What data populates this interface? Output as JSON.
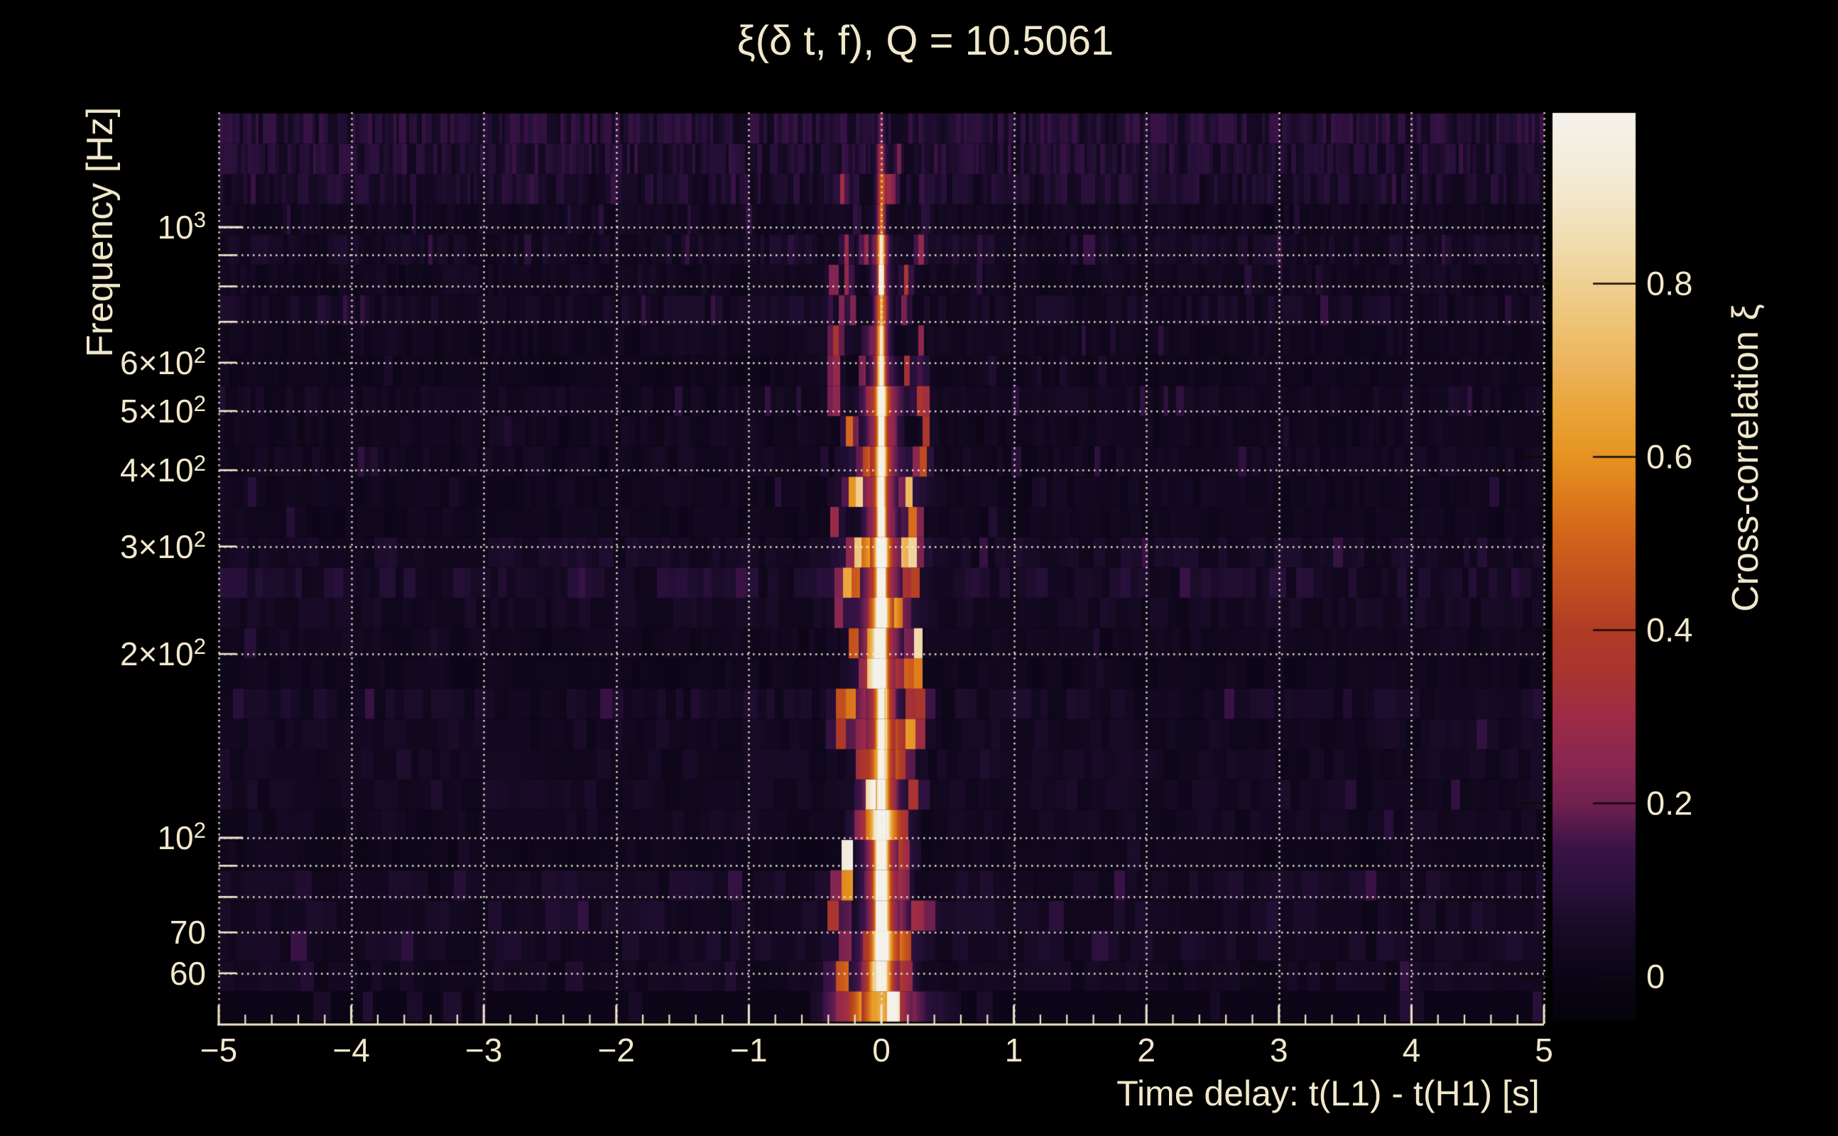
{
  "title": {
    "text": "ξ(δ t, f), Q = 10.5061",
    "q_value": 10.5061
  },
  "colors": {
    "background": "#000000",
    "text": "#f1e8cb",
    "grid": "#f2ecd4",
    "axis": "#f1e8cb",
    "colorbar_tick": "#10090a"
  },
  "chart_data": {
    "type": "heatmap",
    "title": "ξ(δ t, f), Q = 10.5061",
    "xlabel": "Time delay: t(L1) - t(H1) [s]",
    "ylabel": "Frequency [Hz]",
    "colorbar_label": "Cross-correlation ξ",
    "x_range_s": [
      -5,
      5
    ],
    "x_major_tick_step_s": 1,
    "x_minor_tick_step_s": 0.2,
    "y_scale": "log",
    "y_range_hz": [
      50,
      1536
    ],
    "grid": "dotted, at every integer time delay and every decade-multiple frequency",
    "legend_position": "right colorbar",
    "colorbar_value_range": [
      -0.05,
      1.0
    ],
    "colorbar_tick_values": [
      0,
      0.2,
      0.4,
      0.6,
      0.8
    ],
    "colormap_stops": [
      [
        -0.06,
        "#040207"
      ],
      [
        0.0,
        "#0b0516"
      ],
      [
        0.05,
        "#160a24"
      ],
      [
        0.1,
        "#271039"
      ],
      [
        0.15,
        "#3c1347"
      ],
      [
        0.2,
        "#70204f"
      ],
      [
        0.25,
        "#8b2750"
      ],
      [
        0.3,
        "#9d2b46"
      ],
      [
        0.35,
        "#a93430"
      ],
      [
        0.4,
        "#b03c26"
      ],
      [
        0.45,
        "#c14e1f"
      ],
      [
        0.5,
        "#d0601b"
      ],
      [
        0.55,
        "#dc791c"
      ],
      [
        0.6,
        "#e59320"
      ],
      [
        0.65,
        "#e9a337"
      ],
      [
        0.7,
        "#ecb258"
      ],
      [
        0.75,
        "#eec274"
      ],
      [
        0.8,
        "#efd092"
      ],
      [
        0.85,
        "#f1ddb1"
      ],
      [
        0.9,
        "#f3e7cb"
      ],
      [
        0.95,
        "#f4eedf"
      ],
      [
        1.0,
        "#f5f2ec"
      ]
    ],
    "background_noise_xi_range": [
      0.0,
      0.12
    ],
    "ridge": {
      "center_time_delay_s": 0.0,
      "core_width_s_at_100hz": 0.06,
      "side_lobe_offsets_s": [
        -0.3,
        -0.19,
        -0.12,
        0.12,
        0.15,
        0.3
      ],
      "band_peak_xi": [
        {
          "f_hz": [
            50,
            57
          ],
          "peak_xi": 0.55
        },
        {
          "f_hz": [
            57,
            66
          ],
          "peak_xi": 0.9
        },
        {
          "f_hz": [
            66,
            115
          ],
          "peak_xi": 1.0
        },
        {
          "f_hz": [
            115,
            320
          ],
          "peak_xi": 0.95
        },
        {
          "f_hz": [
            320,
            650
          ],
          "peak_xi": 0.85
        },
        {
          "f_hz": [
            650,
            950
          ],
          "peak_xi": 0.7
        },
        {
          "f_hz": [
            950,
            1250
          ],
          "peak_xi": 0.4
        },
        {
          "f_hz": [
            1250,
            1536
          ],
          "peak_xi": 0.2
        }
      ]
    }
  },
  "axes": {
    "x": {
      "title": "Time delay: t(L1) - t(H1) [s]",
      "ticks": [
        {
          "v": -5,
          "label": "−5"
        },
        {
          "v": -4,
          "label": "−4"
        },
        {
          "v": -3,
          "label": "−3"
        },
        {
          "v": -2,
          "label": "−2"
        },
        {
          "v": -1,
          "label": "−1"
        },
        {
          "v": 0,
          "label": "0"
        },
        {
          "v": 1,
          "label": "1"
        },
        {
          "v": 2,
          "label": "2"
        },
        {
          "v": 3,
          "label": "3"
        },
        {
          "v": 4,
          "label": "4"
        },
        {
          "v": 5,
          "label": "5"
        }
      ]
    },
    "y": {
      "title": "Frequency [Hz]",
      "grid_freqs_hz": [
        60,
        70,
        80,
        90,
        100,
        200,
        300,
        400,
        500,
        600,
        700,
        800,
        900,
        1000
      ],
      "ticks": [
        {
          "f": 1000,
          "base": "10",
          "sup": "3"
        },
        {
          "f": 600,
          "base": "6×10",
          "sup": "2"
        },
        {
          "f": 500,
          "base": "5×10",
          "sup": "2"
        },
        {
          "f": 400,
          "base": "4×10",
          "sup": "2"
        },
        {
          "f": 300,
          "base": "3×10",
          "sup": "2"
        },
        {
          "f": 200,
          "base": "2×10",
          "sup": "2"
        },
        {
          "f": 100,
          "base": "10",
          "sup": "2"
        },
        {
          "f": 70,
          "base": "70",
          "sup": ""
        },
        {
          "f": 60,
          "base": "60",
          "sup": ""
        }
      ]
    }
  },
  "colorbar": {
    "title": "Cross-correlation ξ",
    "ticks": [
      {
        "v": 0.8,
        "label": "0.8"
      },
      {
        "v": 0.6,
        "label": "0.6"
      },
      {
        "v": 0.4,
        "label": "0.4"
      },
      {
        "v": 0.2,
        "label": "0.2"
      },
      {
        "v": 0.0,
        "label": "0"
      }
    ]
  }
}
